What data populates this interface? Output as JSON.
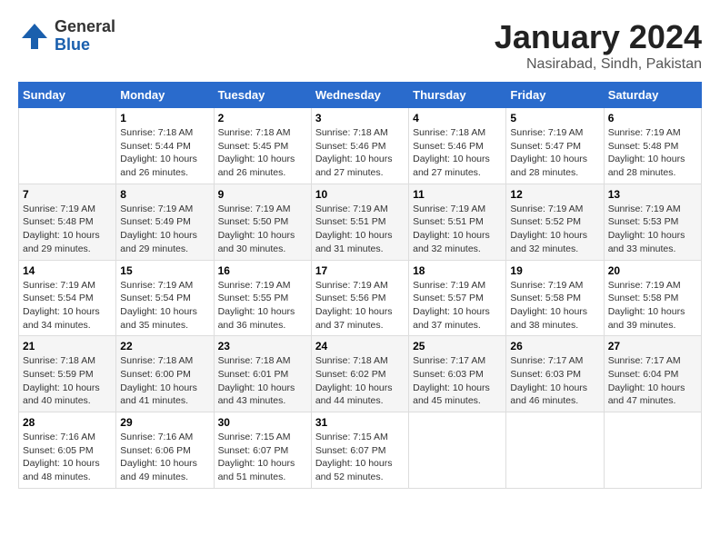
{
  "header": {
    "logo_general": "General",
    "logo_blue": "Blue",
    "title": "January 2024",
    "subtitle": "Nasirabad, Sindh, Pakistan"
  },
  "days_of_week": [
    "Sunday",
    "Monday",
    "Tuesday",
    "Wednesday",
    "Thursday",
    "Friday",
    "Saturday"
  ],
  "weeks": [
    {
      "days": [
        {
          "num": "",
          "info": ""
        },
        {
          "num": "1",
          "info": "Sunrise: 7:18 AM\nSunset: 5:44 PM\nDaylight: 10 hours\nand 26 minutes."
        },
        {
          "num": "2",
          "info": "Sunrise: 7:18 AM\nSunset: 5:45 PM\nDaylight: 10 hours\nand 26 minutes."
        },
        {
          "num": "3",
          "info": "Sunrise: 7:18 AM\nSunset: 5:46 PM\nDaylight: 10 hours\nand 27 minutes."
        },
        {
          "num": "4",
          "info": "Sunrise: 7:18 AM\nSunset: 5:46 PM\nDaylight: 10 hours\nand 27 minutes."
        },
        {
          "num": "5",
          "info": "Sunrise: 7:19 AM\nSunset: 5:47 PM\nDaylight: 10 hours\nand 28 minutes."
        },
        {
          "num": "6",
          "info": "Sunrise: 7:19 AM\nSunset: 5:48 PM\nDaylight: 10 hours\nand 28 minutes."
        }
      ]
    },
    {
      "days": [
        {
          "num": "7",
          "info": "Sunrise: 7:19 AM\nSunset: 5:48 PM\nDaylight: 10 hours\nand 29 minutes."
        },
        {
          "num": "8",
          "info": "Sunrise: 7:19 AM\nSunset: 5:49 PM\nDaylight: 10 hours\nand 29 minutes."
        },
        {
          "num": "9",
          "info": "Sunrise: 7:19 AM\nSunset: 5:50 PM\nDaylight: 10 hours\nand 30 minutes."
        },
        {
          "num": "10",
          "info": "Sunrise: 7:19 AM\nSunset: 5:51 PM\nDaylight: 10 hours\nand 31 minutes."
        },
        {
          "num": "11",
          "info": "Sunrise: 7:19 AM\nSunset: 5:51 PM\nDaylight: 10 hours\nand 32 minutes."
        },
        {
          "num": "12",
          "info": "Sunrise: 7:19 AM\nSunset: 5:52 PM\nDaylight: 10 hours\nand 32 minutes."
        },
        {
          "num": "13",
          "info": "Sunrise: 7:19 AM\nSunset: 5:53 PM\nDaylight: 10 hours\nand 33 minutes."
        }
      ]
    },
    {
      "days": [
        {
          "num": "14",
          "info": "Sunrise: 7:19 AM\nSunset: 5:54 PM\nDaylight: 10 hours\nand 34 minutes."
        },
        {
          "num": "15",
          "info": "Sunrise: 7:19 AM\nSunset: 5:54 PM\nDaylight: 10 hours\nand 35 minutes."
        },
        {
          "num": "16",
          "info": "Sunrise: 7:19 AM\nSunset: 5:55 PM\nDaylight: 10 hours\nand 36 minutes."
        },
        {
          "num": "17",
          "info": "Sunrise: 7:19 AM\nSunset: 5:56 PM\nDaylight: 10 hours\nand 37 minutes."
        },
        {
          "num": "18",
          "info": "Sunrise: 7:19 AM\nSunset: 5:57 PM\nDaylight: 10 hours\nand 37 minutes."
        },
        {
          "num": "19",
          "info": "Sunrise: 7:19 AM\nSunset: 5:58 PM\nDaylight: 10 hours\nand 38 minutes."
        },
        {
          "num": "20",
          "info": "Sunrise: 7:19 AM\nSunset: 5:58 PM\nDaylight: 10 hours\nand 39 minutes."
        }
      ]
    },
    {
      "days": [
        {
          "num": "21",
          "info": "Sunrise: 7:18 AM\nSunset: 5:59 PM\nDaylight: 10 hours\nand 40 minutes."
        },
        {
          "num": "22",
          "info": "Sunrise: 7:18 AM\nSunset: 6:00 PM\nDaylight: 10 hours\nand 41 minutes."
        },
        {
          "num": "23",
          "info": "Sunrise: 7:18 AM\nSunset: 6:01 PM\nDaylight: 10 hours\nand 43 minutes."
        },
        {
          "num": "24",
          "info": "Sunrise: 7:18 AM\nSunset: 6:02 PM\nDaylight: 10 hours\nand 44 minutes."
        },
        {
          "num": "25",
          "info": "Sunrise: 7:17 AM\nSunset: 6:03 PM\nDaylight: 10 hours\nand 45 minutes."
        },
        {
          "num": "26",
          "info": "Sunrise: 7:17 AM\nSunset: 6:03 PM\nDaylight: 10 hours\nand 46 minutes."
        },
        {
          "num": "27",
          "info": "Sunrise: 7:17 AM\nSunset: 6:04 PM\nDaylight: 10 hours\nand 47 minutes."
        }
      ]
    },
    {
      "days": [
        {
          "num": "28",
          "info": "Sunrise: 7:16 AM\nSunset: 6:05 PM\nDaylight: 10 hours\nand 48 minutes."
        },
        {
          "num": "29",
          "info": "Sunrise: 7:16 AM\nSunset: 6:06 PM\nDaylight: 10 hours\nand 49 minutes."
        },
        {
          "num": "30",
          "info": "Sunrise: 7:15 AM\nSunset: 6:07 PM\nDaylight: 10 hours\nand 51 minutes."
        },
        {
          "num": "31",
          "info": "Sunrise: 7:15 AM\nSunset: 6:07 PM\nDaylight: 10 hours\nand 52 minutes."
        },
        {
          "num": "",
          "info": ""
        },
        {
          "num": "",
          "info": ""
        },
        {
          "num": "",
          "info": ""
        }
      ]
    }
  ]
}
